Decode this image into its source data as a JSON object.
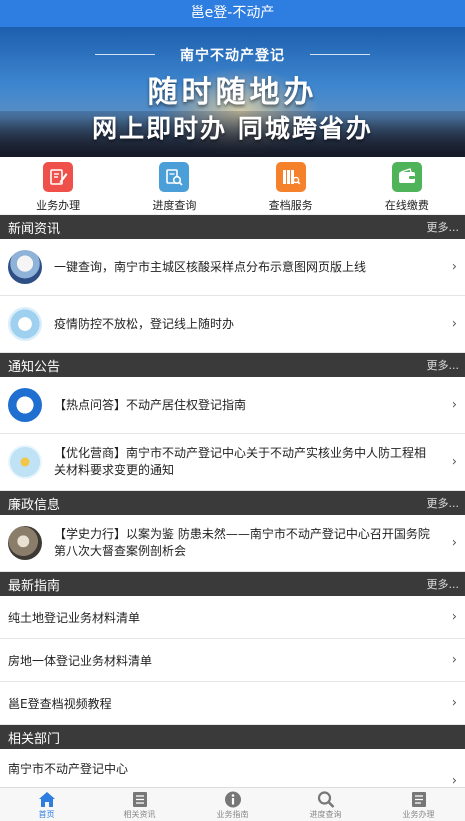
{
  "app": {
    "title": "邕e登-不动产"
  },
  "banner": {
    "heading": "南宁不动产登记",
    "slogan_line1": "随时随地办",
    "slogan_line2": "网上即时办 同城跨省办"
  },
  "quick_actions": [
    {
      "label": "业务办理",
      "icon": "business-edit-icon",
      "color": "#f0504a"
    },
    {
      "label": "进度查询",
      "icon": "progress-search-icon",
      "color": "#4a9fd8"
    },
    {
      "label": "查档服务",
      "icon": "archive-books-icon",
      "color": "#f5812a"
    },
    {
      "label": "在线缴费",
      "icon": "wallet-icon",
      "color": "#4fb35a"
    }
  ],
  "sections": {
    "news": {
      "title": "新闻资讯",
      "more": "更多...",
      "items": [
        {
          "text": "一键查询，南宁市主城区核酸采样点分布示意图网页版上线"
        },
        {
          "text": "疫情防控不放松，登记线上随时办"
        }
      ]
    },
    "notices": {
      "title": "通知公告",
      "more": "更多...",
      "items": [
        {
          "text": "【热点问答】不动产居住权登记指南"
        },
        {
          "text": "【优化营商】南宁市不动产登记中心关于不动产实核业务中人防工程相关材料要求变更的通知"
        }
      ]
    },
    "integrity": {
      "title": "廉政信息",
      "more": "更多...",
      "items": [
        {
          "text": "【学史力行】以案为鉴 防患未然——南宁市不动产登记中心召开国务院第八次大督查案例剖析会"
        }
      ]
    },
    "guides": {
      "title": "最新指南",
      "more": "更多...",
      "items": [
        {
          "text": "纯土地登记业务材料清单"
        },
        {
          "text": "房地一体登记业务材料清单"
        },
        {
          "text": "邕E登查档视频教程"
        }
      ]
    },
    "departments": {
      "title": "相关部门",
      "items": [
        {
          "text": "南宁市不动产登记中心"
        }
      ]
    }
  },
  "tabbar": [
    {
      "label": "首页",
      "icon": "home-icon",
      "active": true
    },
    {
      "label": "相关资讯",
      "icon": "news-list-icon",
      "active": false
    },
    {
      "label": "业务指南",
      "icon": "info-icon",
      "active": false
    },
    {
      "label": "进度查询",
      "icon": "search-icon",
      "active": false
    },
    {
      "label": "业务办理",
      "icon": "business-list-icon",
      "active": false
    }
  ],
  "colors": {
    "primary": "#2e7de0",
    "section_bar": "#3a3a3a"
  }
}
